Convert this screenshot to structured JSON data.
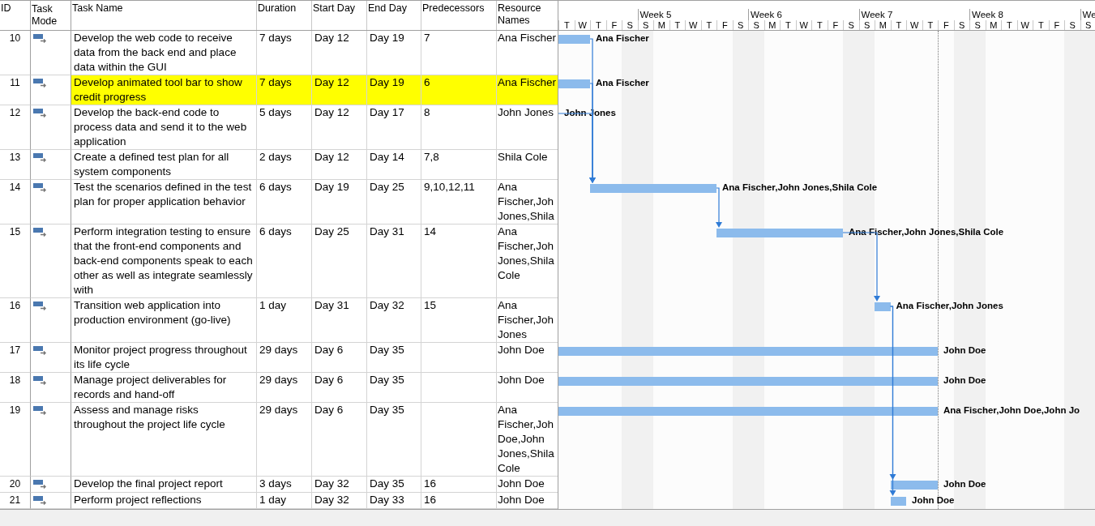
{
  "table": {
    "columns": [
      "ID",
      "Task Mode",
      "Task Name",
      "Duration",
      "Start Day",
      "End Day",
      "Predecessors",
      "Resource Names"
    ],
    "rows": [
      {
        "id": "10",
        "name": "Develop the web code to receive data from the back end and place data within the GUI",
        "duration": "7 days",
        "start": "Day 12",
        "end": "Day 19",
        "predecessors": "7",
        "resources": "Ana Fischer",
        "highlighted": false,
        "bar_label": "Ana Fischer"
      },
      {
        "id": "11",
        "name": "Develop animated tool bar to show credit progress",
        "duration": "7 days",
        "start": "Day 12",
        "end": "Day 19",
        "predecessors": "6",
        "resources": "Ana Fischer",
        "highlighted": true,
        "bar_label": "Ana Fischer"
      },
      {
        "id": "12",
        "name": "Develop the back-end code to process data and send it to the web application",
        "duration": "5 days",
        "start": "Day 12",
        "end": "Day 17",
        "predecessors": "8",
        "resources": "John Jones",
        "highlighted": false,
        "bar_label": "John Jones"
      },
      {
        "id": "13",
        "name": "Create a defined test plan for all system components",
        "duration": "2 days",
        "start": "Day 12",
        "end": "Day 14",
        "predecessors": "7,8",
        "resources": "Shila Cole",
        "highlighted": false
      },
      {
        "id": "14",
        "name": "Test the scenarios defined in the test plan for proper application behavior",
        "duration": "6 days",
        "start": "Day 19",
        "end": "Day 25",
        "predecessors": "9,10,12,11",
        "resources": "Ana Fischer,Joh Jones,Shila",
        "highlighted": false,
        "bar_label": "Ana Fischer,John Jones,Shila Cole"
      },
      {
        "id": "15",
        "name": "Perform integration testing to ensure that the front-end components and back-end components speak to each other as well as integrate seamlessly with",
        "duration": "6 days",
        "start": "Day 25",
        "end": "Day 31",
        "predecessors": "14",
        "resources": "Ana Fischer,Joh Jones,Shila Cole",
        "highlighted": false,
        "bar_label": "Ana Fischer,John Jones,Shila Cole"
      },
      {
        "id": "16",
        "name": "Transition web application into production environment (go-live)",
        "duration": "1 day",
        "start": "Day 31",
        "end": "Day 32",
        "predecessors": "15",
        "resources": "Ana Fischer,Joh Jones",
        "highlighted": false,
        "bar_label": "Ana Fischer,John Jones"
      },
      {
        "id": "17",
        "name": "Monitor project progress throughout its life cycle",
        "duration": "29 days",
        "start": "Day 6",
        "end": "Day 35",
        "resources": "John Doe",
        "highlighted": false,
        "bar_label": "John Doe"
      },
      {
        "id": "18",
        "name": "Manage project deliverables for records and hand-off",
        "duration": "29 days",
        "start": "Day 6",
        "end": "Day 35",
        "resources": "John Doe",
        "highlighted": false,
        "bar_label": "John Doe"
      },
      {
        "id": "19",
        "name": "Assess and manage risks throughout the project life cycle",
        "duration": "29 days",
        "start": "Day 6",
        "end": "Day 35",
        "resources": "Ana Fischer,Joh Doe,John Jones,Shila Cole",
        "highlighted": false,
        "bar_label": "Ana Fischer,John Doe,John Jo"
      },
      {
        "id": "20",
        "name": "Develop the final project report",
        "duration": "3 days",
        "start": "Day 32",
        "end": "Day 35",
        "predecessors": "16",
        "resources": "John Doe",
        "highlighted": false,
        "bar_label": "John Doe"
      },
      {
        "id": "21",
        "name": "Perform project reflections",
        "duration": "1 day",
        "start": "Day 32",
        "end": "Day 33",
        "predecessors": "16",
        "resources": "John Doe",
        "highlighted": false,
        "bar_label": "John Doe"
      }
    ]
  },
  "timescale": {
    "weeks": [
      "Week 5",
      "Week 6",
      "Week 7",
      "Week 8",
      "We"
    ],
    "days": [
      "T",
      "W",
      "T",
      "F",
      "S",
      "S",
      "M",
      "T",
      "W",
      "T",
      "F",
      "S",
      "S",
      "M",
      "T",
      "W",
      "T",
      "F",
      "S",
      "S",
      "M",
      "T",
      "W",
      "T",
      "F",
      "S",
      "S",
      "M",
      "T",
      "W",
      "T",
      "F",
      "S",
      "S"
    ]
  }
}
